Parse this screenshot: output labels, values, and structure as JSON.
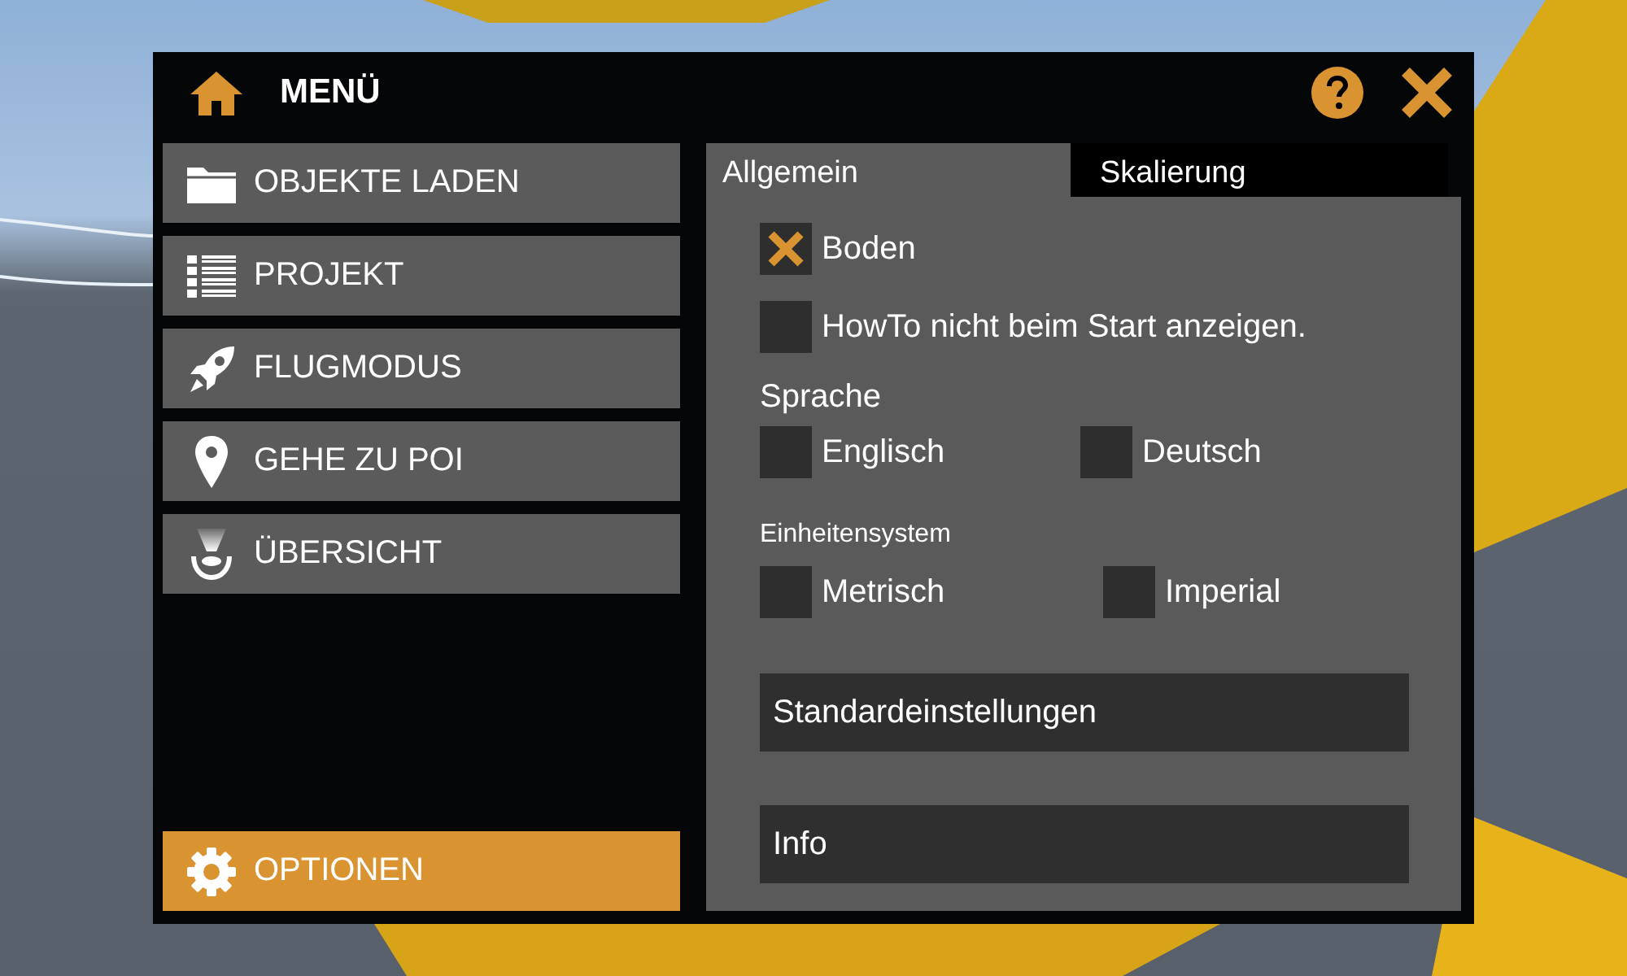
{
  "header": {
    "title": "MENÜ"
  },
  "menu": [
    {
      "label": "OBJEKTE LADEN",
      "selected": false
    },
    {
      "label": "PROJEKT",
      "selected": false
    },
    {
      "label": "FLUGMODUS",
      "selected": false
    },
    {
      "label": "GEHE ZU POI",
      "selected": false
    },
    {
      "label": "ÜBERSICHT",
      "selected": false
    }
  ],
  "menu_bottom": [
    {
      "label": "OPTIONEN",
      "selected": true
    }
  ],
  "tabs": [
    {
      "label": "Allgemein",
      "selected": true
    },
    {
      "label": "Skalierung",
      "selected": false
    }
  ],
  "checkboxes": [
    {
      "label": "Boden",
      "checked": true
    },
    {
      "label": "HowTo nicht beim Start anzeigen.",
      "checked": false
    }
  ],
  "sections": [
    {
      "heading": "Sprache",
      "kind": "large",
      "options": [
        {
          "label": "Englisch",
          "checked": false
        },
        {
          "label": "Deutsch",
          "checked": false
        }
      ]
    },
    {
      "heading": "Einheitensystem",
      "kind": "small",
      "options": [
        {
          "label": "Metrisch",
          "checked": false
        },
        {
          "label": "Imperial",
          "checked": false
        }
      ]
    }
  ],
  "buttons": [
    "Standardeinstellungen",
    "Info"
  ]
}
